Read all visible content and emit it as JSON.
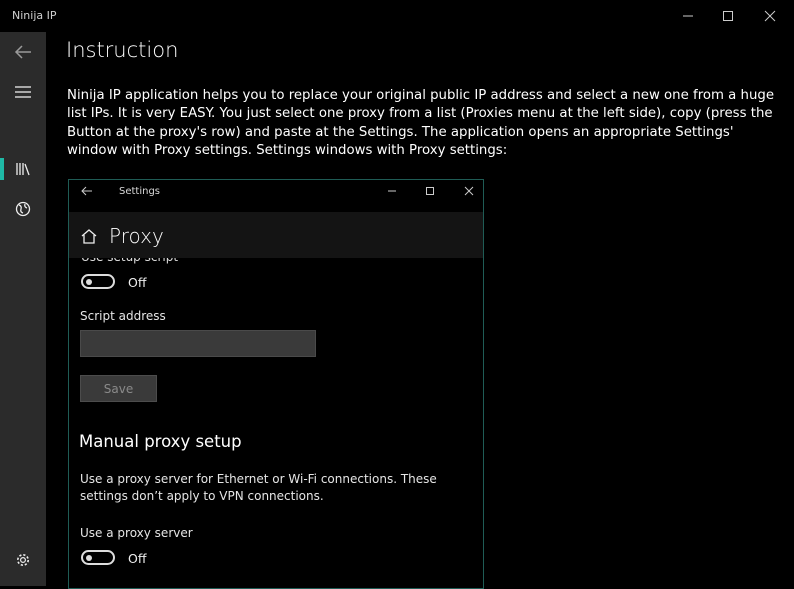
{
  "window": {
    "app_title": "Ninija IP"
  },
  "sidebar": {
    "items": [
      {
        "name": "back-icon"
      },
      {
        "name": "hamburger-menu-icon"
      },
      {
        "name": "instruction-book-icon",
        "selected": true
      },
      {
        "name": "globe-icon"
      },
      {
        "name": "settings-gear-icon"
      }
    ],
    "accent_color": "#1fb9a6"
  },
  "main": {
    "title": "Instruction",
    "description": "Ninija IP application helps you to replace your original public IP address and select a new one from a huge list IPs. It is very EASY. You just select one proxy from a list (Proxies menu at the left side), copy (press the Button at the proxy's row) and paste at the Settings. The application opens an appropriate Settings' window with Proxy settings. Settings windows with Proxy settings:"
  },
  "screenshot": {
    "window_title": "Settings",
    "header": "Proxy",
    "cut_label": "Use setup script",
    "setup_script_toggle": "Off",
    "script_address_label": "Script address",
    "save_label": "Save",
    "manual_heading": "Manual proxy setup",
    "manual_description": "Use a proxy server for Ethernet or Wi-Fi connections. These settings don’t apply to VPN connections.",
    "use_proxy_label": "Use a proxy server",
    "use_proxy_toggle": "Off"
  }
}
